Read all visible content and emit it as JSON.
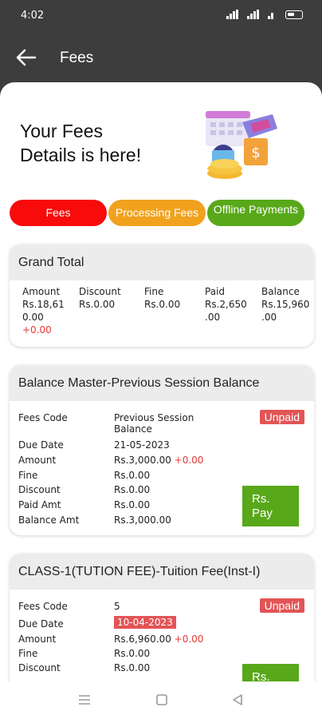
{
  "status": {
    "time": "4:02"
  },
  "app_bar": {
    "title": "Fees"
  },
  "hero": {
    "title_line1": "Your Fees",
    "title_line2": "Details is here!"
  },
  "tabs": [
    {
      "label": "Fees",
      "color": "#f70b0b"
    },
    {
      "label": "Processing Fees",
      "color": "#f0a21f"
    },
    {
      "label": "Offline Payments",
      "color": "#58a81a"
    }
  ],
  "grand_total": {
    "title": "Grand Total",
    "headers": [
      "Amount",
      "Discount",
      "Fine",
      "Paid",
      "Balance"
    ],
    "amount_line1": "Rs.18,61",
    "amount_line2": "0.00",
    "amount_extra": "+0.00",
    "discount": "Rs.0.00",
    "fine": "Rs.0.00",
    "paid_line1": "Rs.2,650",
    "paid_line2": ".00",
    "balance_line1": "Rs.15,960",
    "balance_line2": ".00"
  },
  "fee_cards": [
    {
      "title": "Balance Master-Previous Session Balance",
      "status": "Unpaid",
      "labels": [
        "Fees Code",
        "Due Date",
        "Amount",
        "Fine",
        "Discount",
        "Paid Amt",
        "Balance Amt"
      ],
      "fees_code_line1": "Previous Session",
      "fees_code_line2": "Balance",
      "due_date": "21-05-2023",
      "amount": "Rs.3,000.00",
      "amount_extra": "+0.00",
      "fine": "Rs.0.00",
      "discount": "Rs.0.00",
      "paid_amt": "Rs.0.00",
      "balance_amt": "Rs.3,000.00",
      "pay_label_line1": "Rs.",
      "pay_label_line2": "Pay"
    },
    {
      "title": "CLASS-1(TUTION FEE)-Tuition Fee(Inst-I)",
      "status": "Unpaid",
      "labels": [
        "Fees Code",
        "Due Date",
        "Amount",
        "Fine",
        "Discount"
      ],
      "fees_code": "5",
      "due_date": "10-04-2023",
      "amount": "Rs.6,960.00",
      "amount_extra": "+0.00",
      "fine": "Rs.0.00",
      "discount": "Rs.0.00",
      "pay_label_line1": "Rs."
    }
  ],
  "colors": {
    "status_bar": "#3d3d3d",
    "accent_red": "#e35456",
    "accent_green": "#58a81a"
  }
}
